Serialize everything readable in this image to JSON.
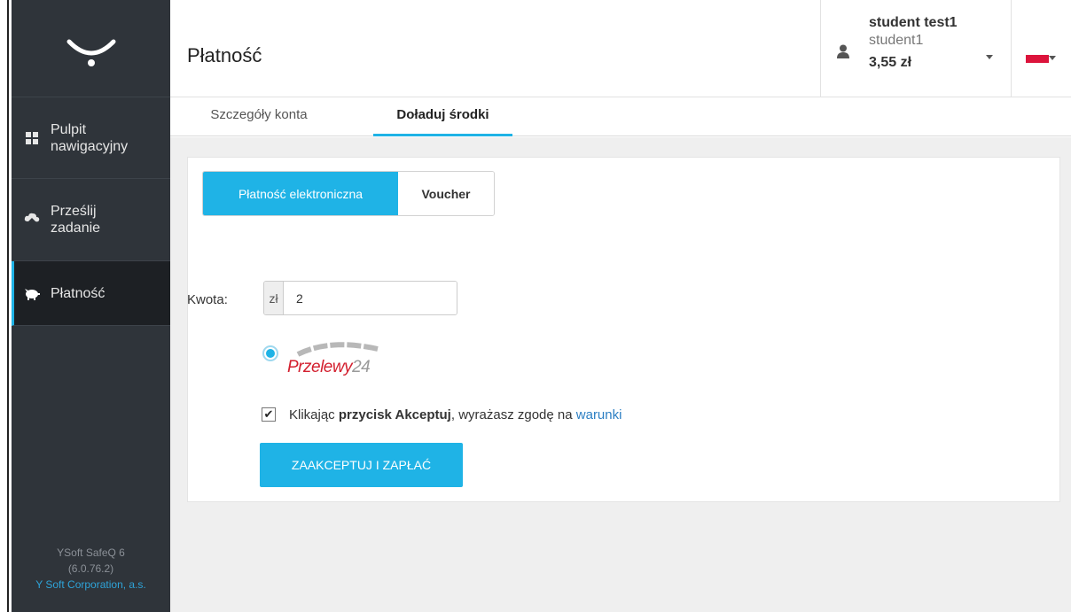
{
  "header": {
    "title": "Płatność",
    "user_name": "student test1",
    "user_login": "student1",
    "balance": "3,55 zł",
    "language_flag": "pl"
  },
  "sidebar": {
    "items": [
      {
        "label_line1": "Pulpit",
        "label_line2": "nawigacyjny",
        "icon": "dashboard-icon"
      },
      {
        "label_line1": "Prześlij",
        "label_line2": "zadanie",
        "icon": "cloud-upload-icon"
      },
      {
        "label_line1": "Płatność",
        "icon": "piggy-bank-icon"
      }
    ],
    "footer": {
      "product": "YSoft SafeQ 6",
      "version": "(6.0.76.2)",
      "company": "Y Soft Corporation, a.s."
    }
  },
  "tabs": [
    {
      "label": "Szczegóły konta"
    },
    {
      "label": "Doładuj środki"
    }
  ],
  "payment": {
    "methods": [
      {
        "label": "Płatność elektroniczna"
      },
      {
        "label": "Voucher"
      }
    ],
    "amount_label": "Kwota:",
    "currency": "zł",
    "amount_value": "2",
    "provider_text": "Przelewy",
    "provider_suffix": "24",
    "consent_prefix": "Klikając ",
    "consent_bold": "przycisk Akceptuj",
    "consent_middle": ", wyrażasz zgodę na ",
    "consent_link": "warunki",
    "submit_label": "ZAAKCEPTUJ I ZAPŁAĆ"
  },
  "colors": {
    "accent": "#1fb3e6",
    "sidebar": "#2f343a",
    "sidebar_active": "#1d2024",
    "link": "#2c7fc3",
    "brand_red": "#d3202f"
  }
}
